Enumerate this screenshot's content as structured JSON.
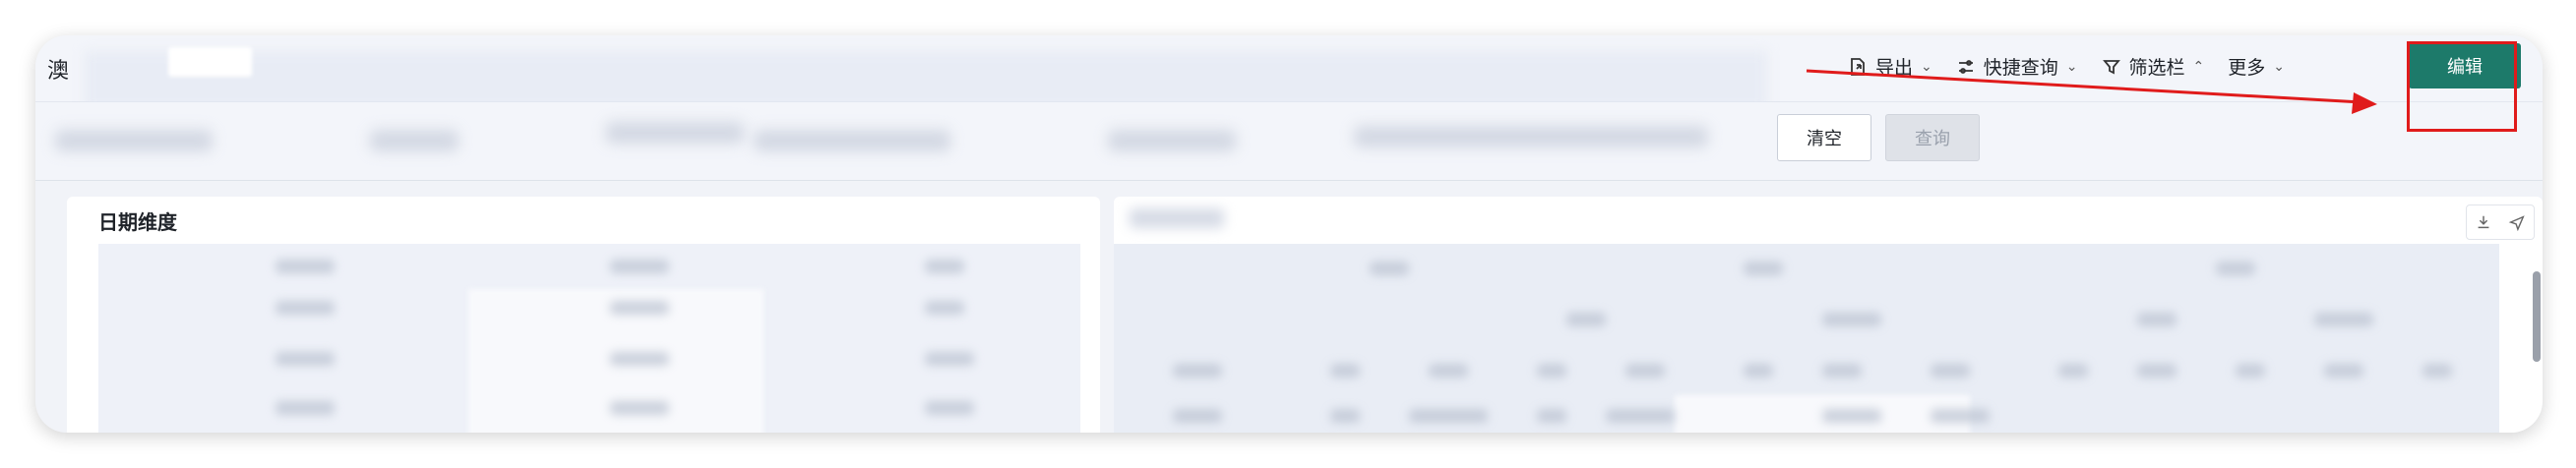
{
  "header": {
    "title": "澳",
    "export_label": "导出",
    "quick_query_label": "快捷查询",
    "filter_bar_label": "筛选栏",
    "more_label": "更多",
    "edit_label": "编辑"
  },
  "filters": {
    "clear_label": "清空",
    "query_label": "查询"
  },
  "panels": {
    "left_title": "日期维度"
  },
  "annotation": {
    "arrow_color": "#e01b1b"
  },
  "colors": {
    "accent": "#1d7a6a",
    "highlight": "#e01b1b"
  }
}
